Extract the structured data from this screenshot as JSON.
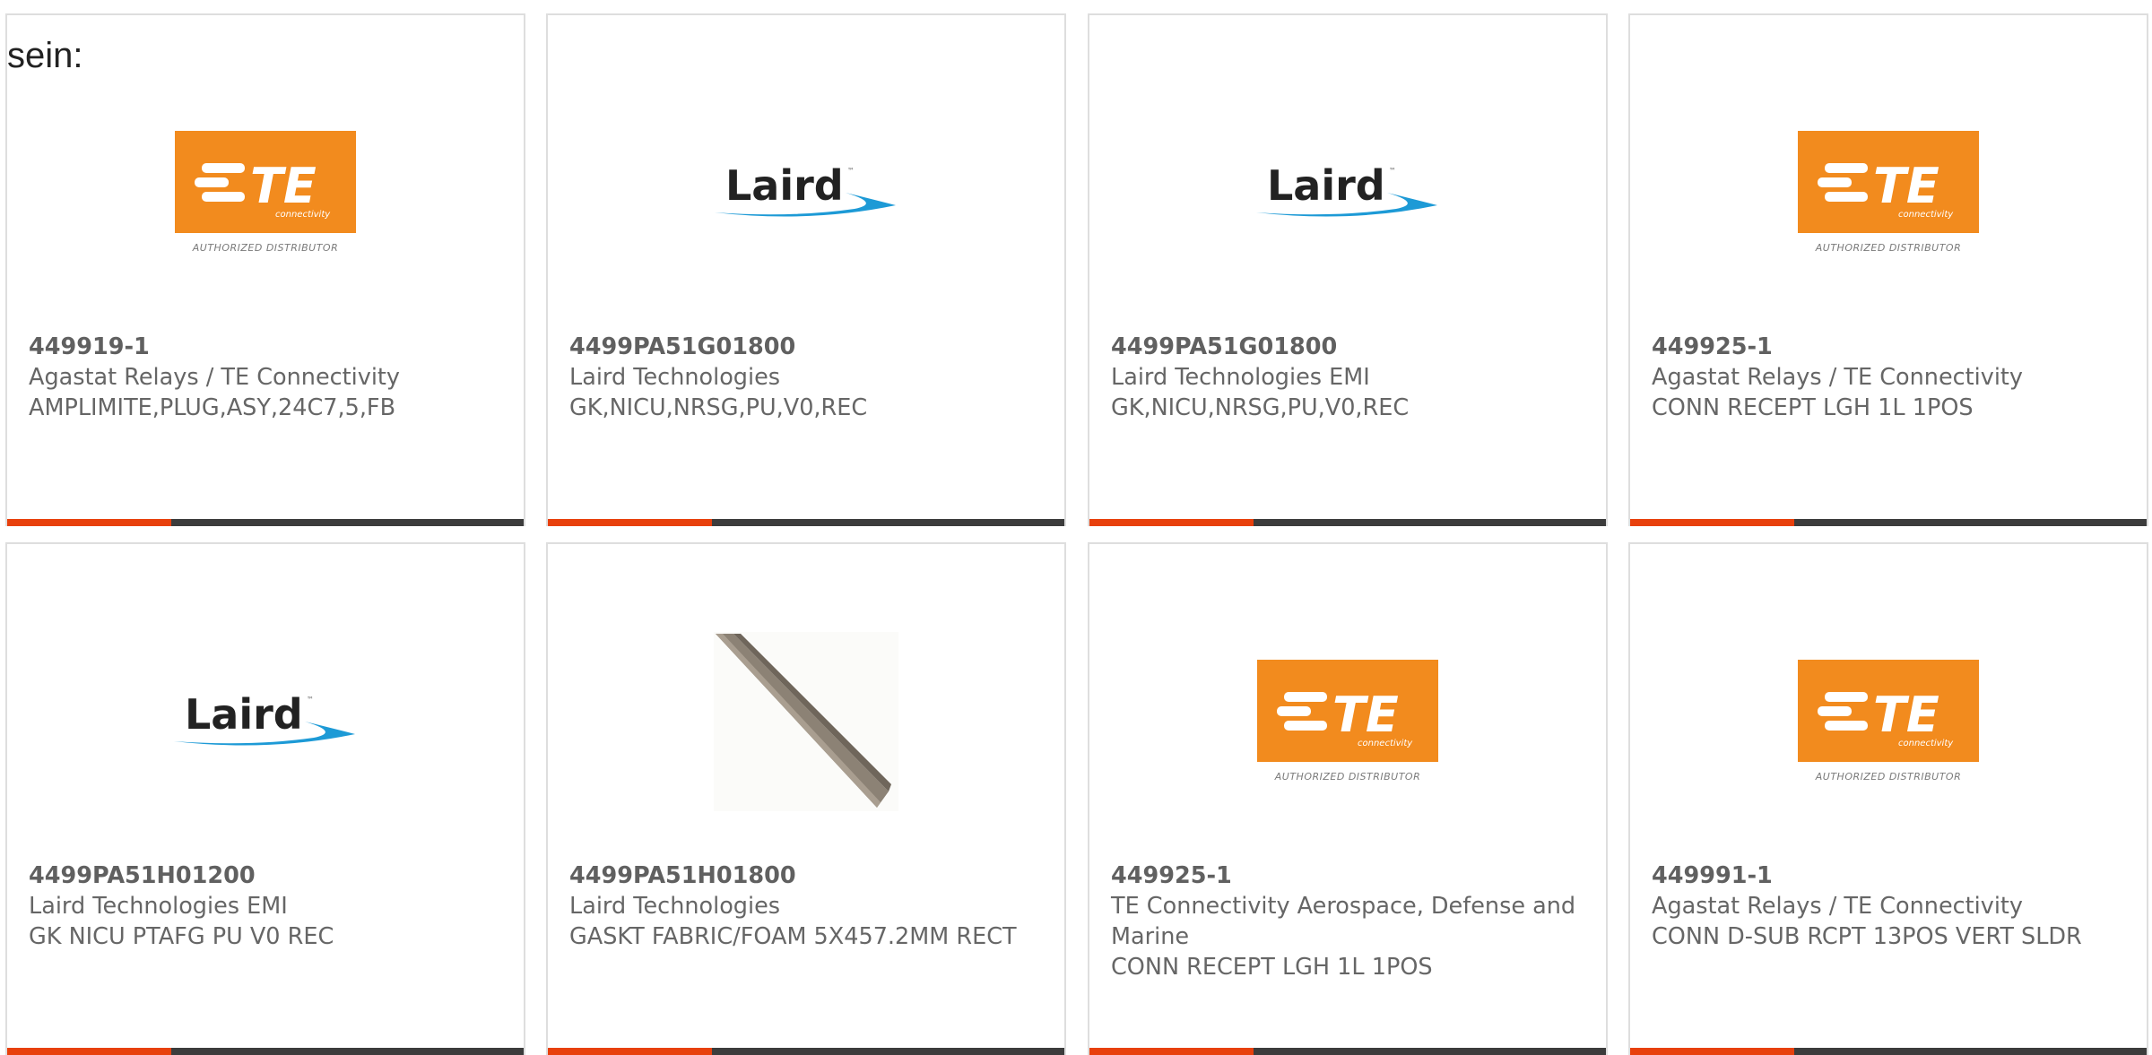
{
  "prefix_text": "sein:",
  "brand": {
    "accent_orange": "#e8400c",
    "bar_dark": "#3c3c3c",
    "te_orange": "#f28b1e"
  },
  "te_logo": {
    "wordmark": "TE",
    "sub": "connectivity",
    "distributor": "AUTHORIZED DISTRIBUTOR"
  },
  "laird_logo": {
    "wordmark": "Laird",
    "tm": "™"
  },
  "products": [
    {
      "image": "te-logo",
      "part_no": "449919-1",
      "manufacturer": "Agastat Relays / TE Connectivity",
      "description": "AMPLIMITE,PLUG,ASY,24C7,5,FB"
    },
    {
      "image": "laird-logo",
      "part_no": "4499PA51G01800",
      "manufacturer": "Laird Technologies",
      "description": "GK,NICU,NRSG,PU,V0,REC"
    },
    {
      "image": "laird-logo",
      "part_no": "4499PA51G01800",
      "manufacturer": "Laird Technologies EMI",
      "description": "GK,NICU,NRSG,PU,V0,REC"
    },
    {
      "image": "te-logo",
      "part_no": "449925-1",
      "manufacturer": "Agastat Relays / TE Connectivity",
      "description": "CONN RECEPT LGH 1L 1POS"
    },
    {
      "image": "laird-logo",
      "part_no": "4499PA51H01200",
      "manufacturer": "Laird Technologies EMI",
      "description": "GK NICU PTAFG PU V0 REC"
    },
    {
      "image": "gasket-photo",
      "part_no": "4499PA51H01800",
      "manufacturer": "Laird Technologies",
      "description": "GASKT FABRIC/FOAM 5X457.2MM RECT"
    },
    {
      "image": "te-logo",
      "part_no": "449925-1",
      "manufacturer": "TE Connectivity Aerospace, Defense and Marine",
      "description": "CONN RECEPT LGH 1L 1POS"
    },
    {
      "image": "te-logo",
      "part_no": "449991-1",
      "manufacturer": "Agastat Relays / TE Connectivity",
      "description": "CONN D-SUB RCPT 13POS VERT SLDR"
    }
  ]
}
